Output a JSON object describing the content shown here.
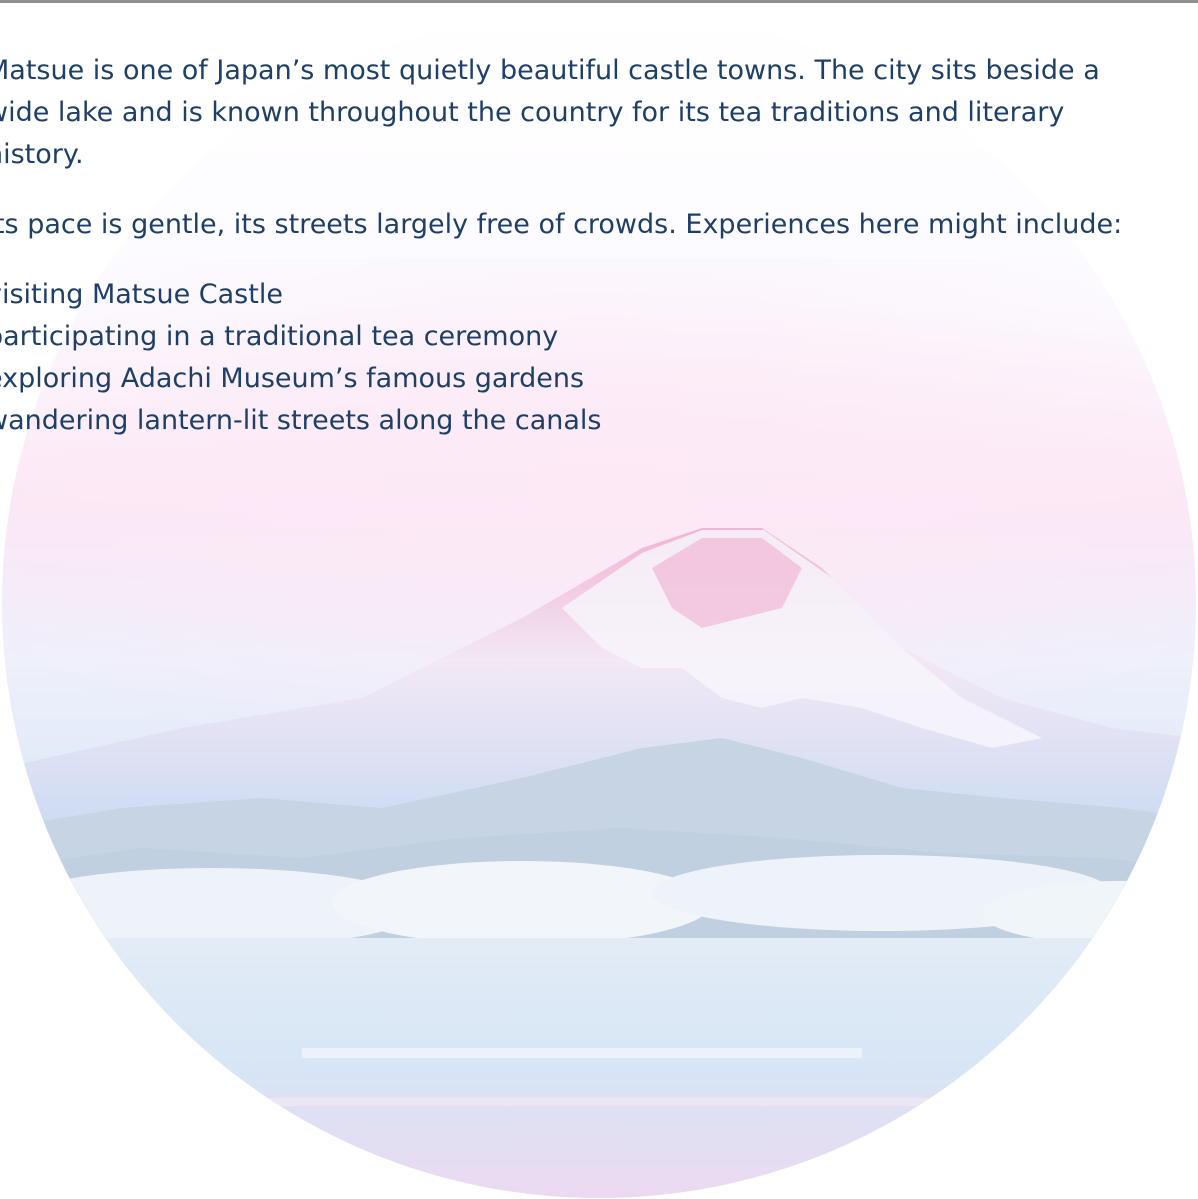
{
  "article": {
    "intro_paragraph": "Matsue is one of Japan’s most quietly beautiful castle towns. The city sits beside a wide lake and is known throughout the country for its tea traditions and literary history.",
    "pace_paragraph": "Its pace is gentle, its streets largely free of crowds. Experiences here might include:",
    "experiences": [
      "visiting Matsue Castle",
      "participating in a traditional tea ceremony",
      "exploring Adachi Museum’s famous gardens",
      "wandering lantern-lit streets along the canals"
    ]
  },
  "hero_image": {
    "icon": "mountain-lake-illustration",
    "colors": {
      "sky_top": "#fbfdff",
      "sky_pink": "#fbe3f3",
      "mountain": "#bcd8f5",
      "snow": "#f6f4fb",
      "summit_pink": "#f3b5d3",
      "hills": "#c9d7e6",
      "clouds": "#eef3f9",
      "lake": "#dbe8f6"
    }
  },
  "accent": {
    "text_color": "#1e3f66",
    "rule_color": "#8e8e8e"
  }
}
